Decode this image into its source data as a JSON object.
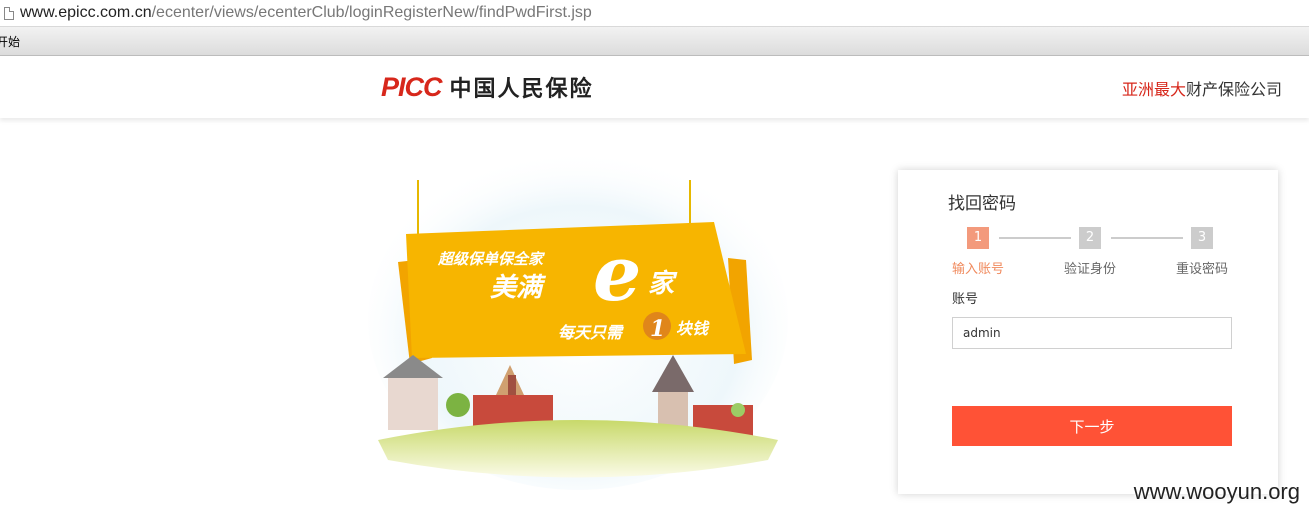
{
  "browser": {
    "url_host": "www.epicc.com.cn",
    "url_path": "/ecenter/views/ecenterClub/loginRegisterNew/findPwdFirst.jsp",
    "bookmark_label": "开始"
  },
  "header": {
    "logo_en": "PICC",
    "logo_cn": "中国人民保险",
    "slogan_red": "亚洲最大",
    "slogan_rest": "财产保险公司"
  },
  "banner": {
    "line1": "超级保单保全家",
    "line2": "美满",
    "big_letter": "e",
    "line2_end": "家",
    "line3_start": "每天只需",
    "number": "1",
    "line3_end": "块钱"
  },
  "card": {
    "title": "找回密码",
    "steps": [
      {
        "num": "1",
        "label": "输入账号"
      },
      {
        "num": "2",
        "label": "验证身份"
      },
      {
        "num": "3",
        "label": "重设密码"
      }
    ],
    "account_label": "账号",
    "account_value": "admin",
    "next_button": "下一步"
  },
  "watermark": "www.wooyun.org",
  "colors": {
    "brand_red": "#d7271b",
    "button": "#ff5236",
    "step_active": "#f39a7c",
    "banner_yellow": "#f7b500"
  }
}
